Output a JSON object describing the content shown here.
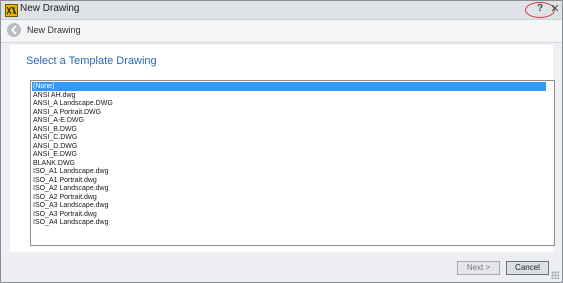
{
  "window": {
    "title": "New Drawing"
  },
  "titlebar": {
    "help_glyph": "?",
    "close_glyph": "✕"
  },
  "nav": {
    "title": "New Drawing"
  },
  "main": {
    "heading": "Select a Template Drawing",
    "templates": [
      "(None)",
      "ANSI AH.dwg",
      "ANSI_A Landscape.DWG",
      "ANSI_A Portrait.DWG",
      "ANSI_A-E.DWG",
      "ANSI_B.DWG",
      "ANSI_C.DWG",
      "ANSI_D.DWG",
      "ANSI_E.DWG",
      "BLANK.DWG",
      "ISO_A1 Landscape.dwg",
      "ISO_A1 Portrait.dwg",
      "ISO_A2 Landscape.dwg",
      "ISO_A2 Portrait.dwg",
      "ISO_A3 Landscape.dwg",
      "ISO_A3 Portrait.dwg",
      "ISO_A4 Landscape.dwg"
    ],
    "selected_index": 0
  },
  "footer": {
    "next_label": "Next >",
    "cancel_label": "Cancel"
  },
  "colors": {
    "accent": "#2a6ab2",
    "selection": "#3399ff",
    "highlight_ring": "#cf3a3a"
  }
}
